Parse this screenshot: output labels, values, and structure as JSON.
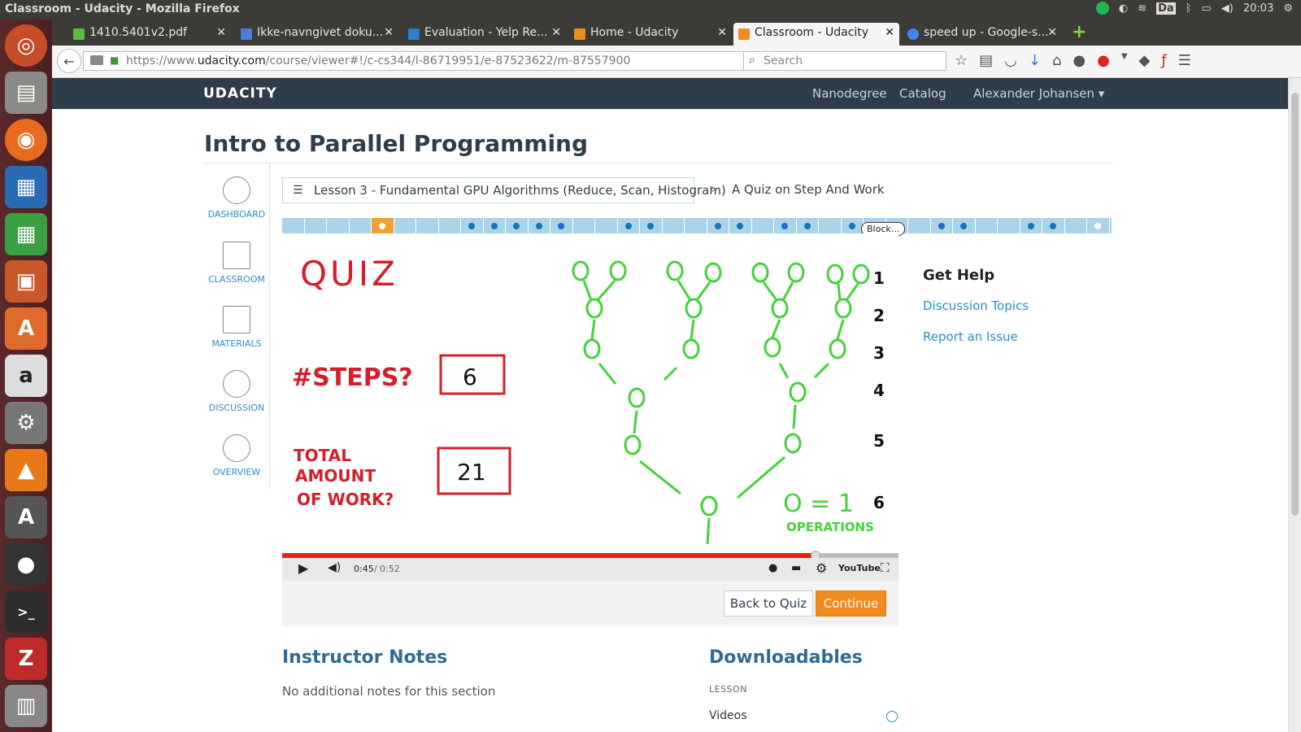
{
  "window": {
    "title": "Classroom - Udacity - Mozilla Firefox",
    "clock": "20:03",
    "tray_text": "Da"
  },
  "tabs": [
    {
      "label": "1410.5401v2.pdf",
      "favicon_color": "#5bbf3b"
    },
    {
      "label": "Ikke-navngivet doku...",
      "favicon_color": "#4a7fe0"
    },
    {
      "label": "Evaluation - Yelp Re...",
      "favicon_color": "#2a7fd0"
    },
    {
      "label": "Home - Udacity",
      "favicon_color": "#f28b1e"
    },
    {
      "label": "Classroom - Udacity",
      "favicon_color": "#f28b1e",
      "active": true
    },
    {
      "label": "speed up - Google-s...",
      "favicon_color": "#4285f4"
    }
  ],
  "tab_close_glyph": "✕",
  "browser": {
    "url_prefix": "https://www.",
    "url_domain": "udacity.com",
    "url_path": "/course/viewer#!/c-cs344/l-86719951/e-87523622/m-87557900",
    "search_placeholder": "Search"
  },
  "udacity": {
    "logo": "UDACITY",
    "nav": [
      "Nanodegree",
      "Catalog",
      "Alexander Johansen ▾"
    ]
  },
  "page_title": "Intro to Parallel Programming",
  "sidenav": [
    "DASHBOARD",
    "CLASSROOM",
    "MATERIALS",
    "DISCUSSION",
    "OVERVIEW"
  ],
  "breadcrumb": {
    "lesson": "Lesson 3 - Fundamental GPU Algorithms (Reduce, Scan, Histogram)",
    "separator": ">",
    "current": "A Quiz on Step And Work"
  },
  "progress_tooltip": "Block...",
  "video": {
    "quiz_title": "QUIZ",
    "steps_question": "#STEPS?",
    "steps_answer": "6",
    "work_question_lines": [
      "TOTAL",
      "AMOUNT",
      "OF WORK?"
    ],
    "work_answer": "21",
    "level_labels": [
      "1",
      "2",
      "3",
      "4",
      "5",
      "6"
    ],
    "legend_eq": "O = 1",
    "legend_text": "OPERATIONS",
    "time_current": "0:45",
    "time_total": "0:52",
    "played_fraction": 0.865,
    "youtube_label": "YouTube"
  },
  "actions": {
    "back": "Back to Quiz",
    "continue": "Continue"
  },
  "help": {
    "title": "Get Help",
    "links": [
      "Discussion Topics",
      "Report an Issue"
    ]
  },
  "notes": {
    "title": "Instructor Notes",
    "text": "No additional notes for this section"
  },
  "downloads": {
    "title": "Downloadables",
    "lesson_label": "LESSON",
    "videos_label": "Videos"
  }
}
